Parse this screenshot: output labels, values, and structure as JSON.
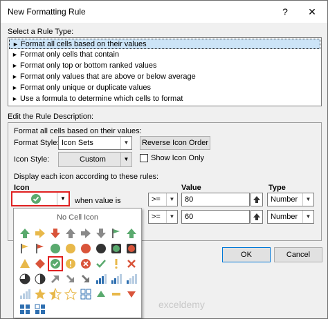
{
  "window": {
    "title": "New Formatting Rule",
    "help": "?",
    "close": "✕"
  },
  "rule_type": {
    "label": "Select a Rule Type:",
    "items": [
      "Format all cells based on their values",
      "Format only cells that contain",
      "Format only top or bottom ranked values",
      "Format only values that are above or below average",
      "Format only unique or duplicate values",
      "Use a formula to determine which cells to format"
    ],
    "arrow": "►"
  },
  "description": {
    "label": "Edit the Rule Description:",
    "heading": "Format all cells based on their values:",
    "format_style_label": "Format Style:",
    "format_style_value": "Icon Sets",
    "reverse_button": "Reverse Icon Order",
    "icon_style_label": "Icon Style:",
    "icon_style_value": "Custom",
    "show_icon_only": "Show Icon Only",
    "display_rules": "Display each icon according to these rules:",
    "col_icon": "Icon",
    "col_value": "Value",
    "col_type": "Type",
    "when_text": "when value is",
    "rows": [
      {
        "op": ">=",
        "value": "80",
        "type": "Number"
      },
      {
        "op": ">=",
        "value": "60",
        "type": "Number"
      }
    ]
  },
  "popup": {
    "no_cell_icon": "No Cell Icon"
  },
  "buttons": {
    "ok": "OK",
    "cancel": "Cancel"
  },
  "watermark": "exceldemy",
  "colors": {
    "green": "#5aaa6e",
    "yellow": "#e8b84a",
    "red": "#d9543a",
    "gray": "#8a8a8a",
    "blue": "#2f6fb0",
    "black": "#333333"
  }
}
